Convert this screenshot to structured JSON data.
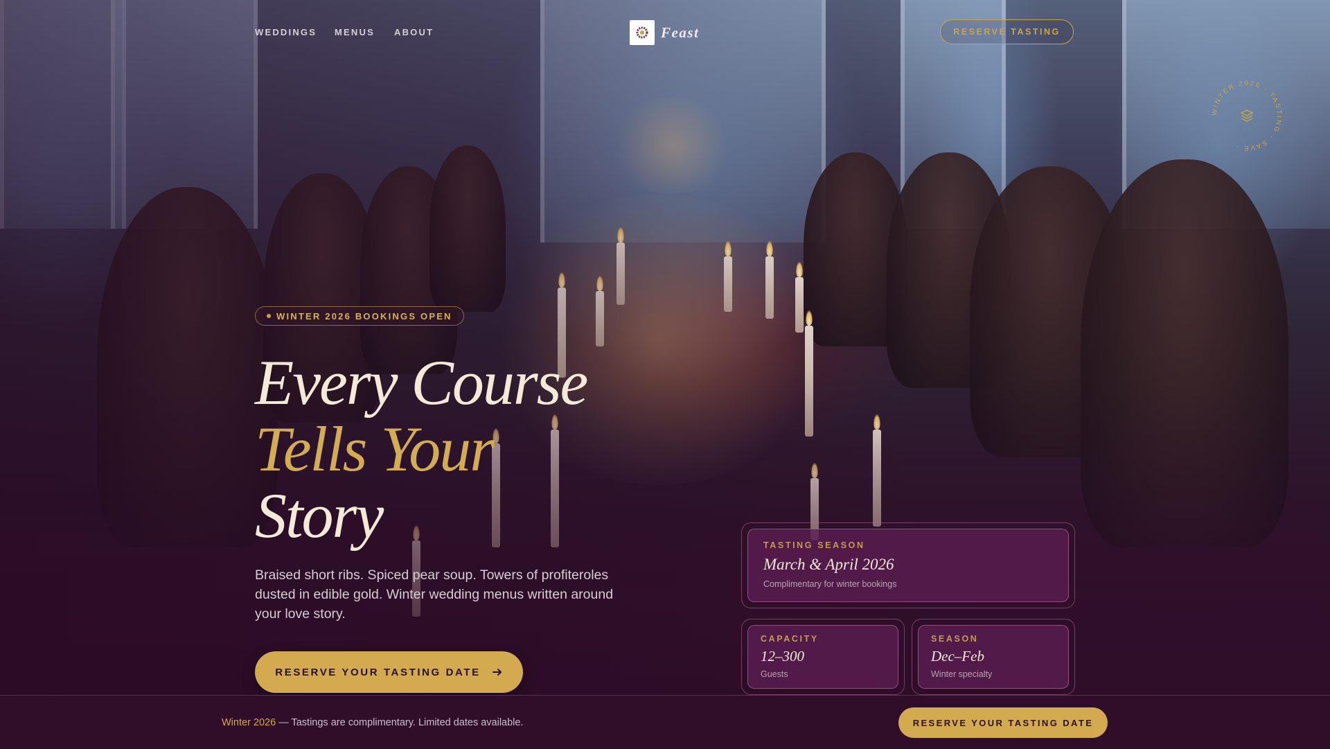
{
  "nav": {
    "links": [
      {
        "label": "WEDDINGS"
      },
      {
        "label": "MENUS"
      },
      {
        "label": "ABOUT"
      }
    ],
    "brand": "Feast",
    "reserve_label": "RESERVE TASTING"
  },
  "badge": {
    "ring_text": "WINTER 2026 · TASTING · SAVE ·"
  },
  "hero": {
    "pill": "WINTER 2026 BOOKINGS OPEN",
    "headline": {
      "line1": "Every Course",
      "line2": "Tells Your",
      "line3": "Story"
    },
    "subtext": "Braised short ribs. Spiced pear soup. Towers of profiteroles dusted in edible gold. Winter wedding menus written around your love story.",
    "cta_label": "RESERVE YOUR TASTING DATE"
  },
  "cards": {
    "tasting": {
      "label": "TASTING SEASON",
      "value": "March & April 2026",
      "note": "Complimentary for winter bookings"
    },
    "capacity": {
      "label": "CAPACITY",
      "value": "12–300",
      "note": "Guests"
    },
    "season": {
      "label": "SEASON",
      "value": "Dec–Feb",
      "note": "Winter specialty"
    }
  },
  "bottom_bar": {
    "highlight": "Winter 2026",
    "text": " — Tastings are complimentary. Limited dates available.",
    "cta_label": "RESERVE YOUR TASTING DATE"
  },
  "colors": {
    "gold": "#d3aa50",
    "plum": "#300e2a",
    "cream": "#f4ead7"
  },
  "icons": {
    "logo": "wreath-logo-icon",
    "badge": "layers-icon",
    "cta": "arrow-right-icon"
  }
}
